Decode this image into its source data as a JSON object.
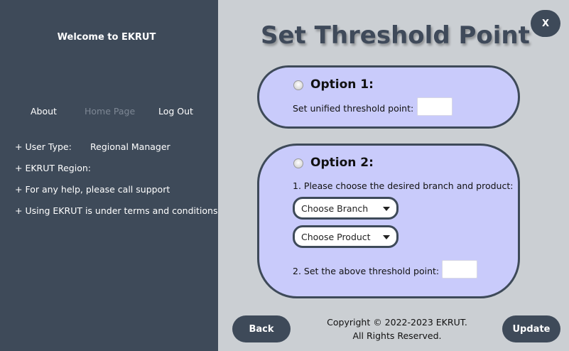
{
  "sidebar": {
    "welcome": "Welcome to EKRUT",
    "nav": {
      "about": "About",
      "home": "Home Page",
      "logout": "Log Out"
    },
    "info": {
      "user_type_label": "+ User Type:",
      "user_type_value": "Regional Manager",
      "region_label": "+ EKRUT Region:",
      "help": "+ For any help, please call support",
      "terms": "+ Using EKRUT is under terms and conditions"
    }
  },
  "main": {
    "title": "Set Threshold Point",
    "close_label": "X",
    "option1": {
      "title": "Option 1:",
      "text": "Set unified threshold point:",
      "value": ""
    },
    "option2": {
      "title": "Option 2:",
      "step1": "1. Please choose the desired branch and product:",
      "branch_combo": "Choose Branch",
      "product_combo": "Choose Product",
      "step2": "2. Set the above threshold point:",
      "value": ""
    },
    "back_label": "Back",
    "update_label": "Update",
    "copyright_line1": "Copyright © 2022-2023 EKRUT.",
    "copyright_line2": "All Rights Reserved."
  },
  "colors": {
    "sidebar_bg": "#3e4a59",
    "main_bg": "#cbcfd3",
    "option_bg": "#c9cbfb",
    "accent": "#3e4a59"
  }
}
